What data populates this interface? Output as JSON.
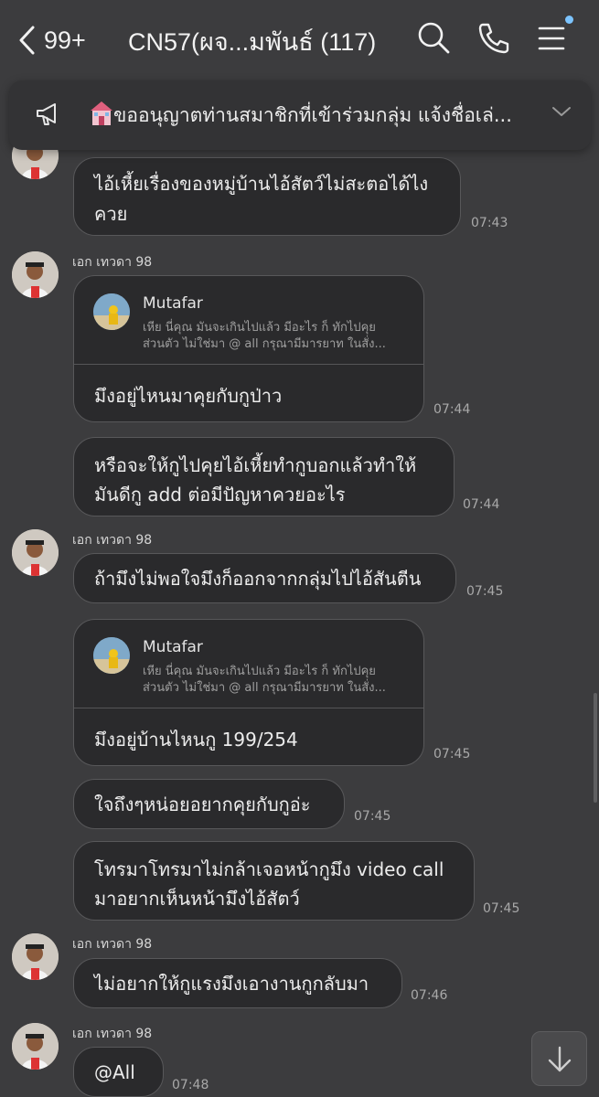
{
  "header": {
    "back_count": "99+",
    "title": "CN57(ผจ...มพันธ์ (117)"
  },
  "announcement": {
    "text": "ขออนุญาตท่านสมาชิกที่เข้าร่วมกลุ่ม แจ้งชื่อเล่..."
  },
  "messages": [
    {
      "lines": [
        "ไอ้เหี้ยเรื่องของหมู่บ้านไอ้สัตว์ไม่สะตอได้ไง",
        "ควย"
      ],
      "time": "07:43"
    },
    {
      "sender": "เอก เทวดา 98",
      "reply": {
        "name": "Mutafar",
        "line1": "เหีย นี่คุณ มันจะเกินไปแล้ว มีอะไร ก็ ทักไปคุย",
        "line2": "ส่วนตัว ไม่ใช่มา @ all กรุณามีมารยาท ในสั่ง..."
      },
      "lines": [
        "มึงอยู่ไหนมาคุยกับกูป่าว"
      ],
      "time": "07:44"
    },
    {
      "lines": [
        "หรือจะให้กูไปคุยไอ้เหี้ยทำกูบอกแล้วทำให้",
        "มันดีกู add ต่อมีปัญหาควยอะไร"
      ],
      "time": "07:44"
    },
    {
      "sender": "เอก เทวดา 98",
      "lines": [
        "ถ้ามึงไม่พอใจมึงก็ออกจากกลุ่มไปไอ้สันตีน"
      ],
      "time": "07:45"
    },
    {
      "reply": {
        "name": "Mutafar",
        "line1": "เหีย นี่คุณ มันจะเกินไปแล้ว มีอะไร ก็ ทักไปคุย",
        "line2": "ส่วนตัว ไม่ใช่มา @ all กรุณามีมารยาท ในสั่ง..."
      },
      "lines": [
        "มึงอยู่บ้านไหนกู 199/254"
      ],
      "time": "07:45"
    },
    {
      "lines": [
        "ใจถึงๆหน่อยอยากคุยกับกูอ่ะ"
      ],
      "time": "07:45"
    },
    {
      "lines": [
        "โทรมาโทรมาไม่กล้าเจอหน้ากูมึง video call",
        "มาอยากเห็นหน้ามึงไอ้สัตว์"
      ],
      "time": "07:45"
    },
    {
      "sender": "เอก เทวดา 98",
      "lines": [
        "ไม่อยากให้กูแรงมึงเอางานกูกลับมา"
      ],
      "time": "07:46"
    },
    {
      "sender": "เอก เทวดา 98",
      "lines": [
        "@All"
      ],
      "time": "07:48"
    }
  ],
  "colors": {
    "background": "#3c3c3e",
    "bubble": "#2a2a2c",
    "mention": "#9ec9f5",
    "notification_dot": "#7cc4ff"
  },
  "icons": [
    "back-chevron-icon",
    "search-icon",
    "phone-icon",
    "menu-icon",
    "megaphone-icon",
    "house-emoji-icon",
    "chevron-down-icon",
    "arrow-down-icon"
  ]
}
